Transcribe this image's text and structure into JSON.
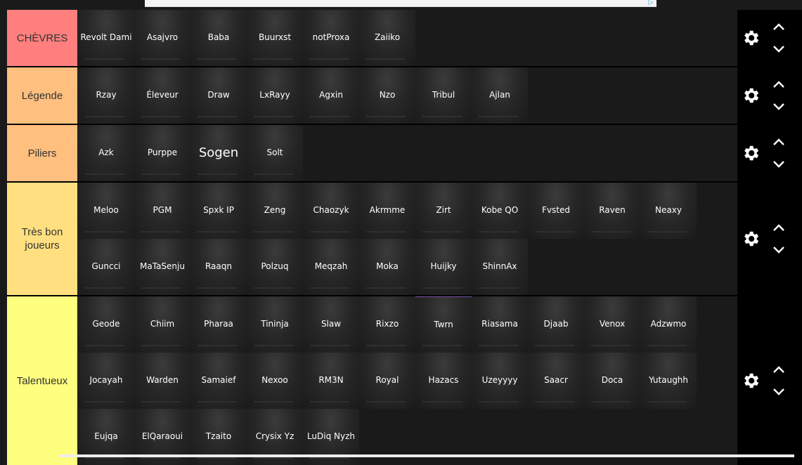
{
  "tiers": [
    {
      "label": "CHÈVRES",
      "color": "#ff7f7f",
      "items": [
        "Revolt Dami",
        "Asajvro",
        "Baba",
        "Buurxst",
        "notProxa",
        "Zaiiko"
      ]
    },
    {
      "label": "Légende",
      "color": "#ffbf7f",
      "items": [
        "Rzay",
        "Éleveur",
        "Draw",
        "LxRayy",
        "Agxin",
        "Nzo",
        "Tribul",
        "Ajlan"
      ]
    },
    {
      "label": "Piliers",
      "color": "#ffbf7f",
      "items": [
        "Azk",
        "Purppe",
        "Sogen",
        "Solt"
      ]
    },
    {
      "label": "Très bon joueurs",
      "color": "#ffdf7f",
      "items": [
        "Meloo",
        "PGM",
        "Spxk IP",
        "Zeng",
        "Chaozyk",
        "Akrmme",
        "Zirt",
        "Kobe QO",
        "Fvsted",
        "Raven",
        "Neaxy",
        "Guncci",
        "MaTaSenju",
        "Raaqn",
        "Polzuq",
        "Meqzah",
        "Moka",
        "Huijky",
        "ShinnAx"
      ]
    },
    {
      "label": "Talentueux",
      "color": "#ffff7f",
      "items": [
        "Geode",
        "Chiim",
        "Pharaa",
        "Tininja",
        "Slaw",
        "Rixzo",
        "Twrn",
        "Riasama",
        "Djaab",
        "Venox",
        "Adzwmo",
        "Jocayah",
        "Warden",
        "Samaief",
        "Nexoo",
        "RM3N",
        "Royal",
        "Hazacs",
        "Uzeyyyy",
        "Saacr",
        "Doca",
        "Yutaughh",
        "Eujqa",
        "ElQaraoui",
        "Tzaito",
        "Crysix Yz",
        "LuDiq Nyzh"
      ]
    }
  ],
  "icons": {
    "settings": "gear-icon",
    "up": "chevron-up-icon",
    "down": "chevron-down-icon",
    "ad": "adchoices-icon"
  }
}
